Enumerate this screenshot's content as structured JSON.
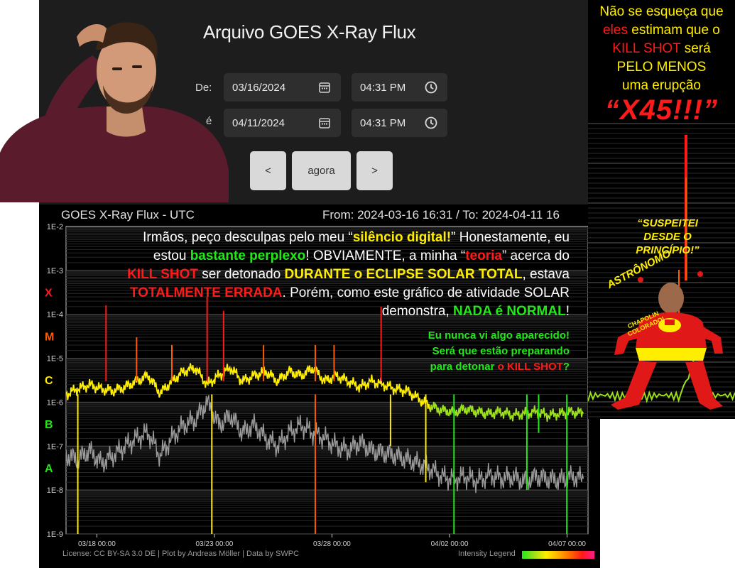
{
  "app": {
    "title": "Arquivo GOES X-Ray Flux"
  },
  "form": {
    "from_label": "De:",
    "to_label": "é",
    "from_date": "03/16/2024",
    "from_time": "04:31 PM",
    "to_date": "04/11/2024",
    "to_time": "04:31 PM",
    "prev": "<",
    "now": "agora",
    "next": ">"
  },
  "chart_header": {
    "title": "GOES X-Ray Flux - UTC",
    "range": "From: 2024-03-16 16:31  /  To: 2024-04-11 16"
  },
  "overlay": {
    "l1a": "Irmãos, peço desculpas pelo meu “",
    "l1b": "silêncio digital!",
    "l1c": "”   Honestamente, eu",
    "l2a": "estou ",
    "l2b": "bastante perplexo",
    "l2c": "!   OBVIAMENTE, a minha “",
    "l2d": "teoria",
    "l2e": "” acerca do",
    "l3a": "KILL SHOT",
    "l3b": " ser detonado ",
    "l3c": "DURANTE o ECLIPSE SOLAR TOTAL",
    "l3d": ", estava",
    "l4a": "TOTALMENTE ERRADA",
    "l4b": ".   Porém, como este gráfico de atividade SOLAR",
    "l5a": "demonstra, ",
    "l5b": "NADA é NORMAL",
    "l5c": "!",
    "g1": "Eu nunca vi algo aparecido!",
    "g2": "Será que estão preparando",
    "g3a": "para detonar ",
    "g3b": "o KILL SHOT",
    "g3c": "?"
  },
  "side_note": {
    "l1": "Não se esqueça que",
    "l2a": "eles",
    "l2b": " estimam que o",
    "l3a": "KILL SHOT",
    "l3b": " será",
    "l4": "PELO MENOS",
    "l5": "uma erupção",
    "big": "“X45!!!”",
    "susp1": "“SUSPEITEI",
    "susp2": "DESDE O",
    "susp3": "PRINCÍPIO!”",
    "astro": "ASTRÔNOMO",
    "chapo1": "CHAPOLIN",
    "chapo2": "COLORADO!"
  },
  "footer": {
    "license": "License: CC BY-SA 3.0 DE | Plot by Andreas Möller | Data by SWPC",
    "legend": "Intensity Legend"
  },
  "colors": {
    "long": "#ffee00",
    "short": "#9a9a9a",
    "m_class": "#ff5a00",
    "x_class": "#ff1a1a",
    "c_class": "#ffee00",
    "b_class": "#9be01a",
    "a_class": "#22e81a"
  },
  "chart_data": {
    "type": "line",
    "title": "GOES X-Ray Flux - UTC",
    "y_scale": "log",
    "ylim": [
      1e-09,
      0.01
    ],
    "y_ticks": [
      "1E-2",
      "1E-3",
      "1E-4",
      "1E-5",
      "1E-6",
      "1E-7",
      "1E-8",
      "1E-9"
    ],
    "class_labels": [
      {
        "label": "X",
        "value": 0.0001,
        "color": "#ff1a1a"
      },
      {
        "label": "M",
        "value": 1e-05,
        "color": "#ff5a00"
      },
      {
        "label": "C",
        "value": 1e-06,
        "color": "#ffee00"
      },
      {
        "label": "B",
        "value": 1e-07,
        "color": "#22e81a"
      },
      {
        "label": "A",
        "value": 1e-08,
        "color": "#22e81a"
      }
    ],
    "x_tick_labels": [
      "03/18 00:00",
      "03/23 00:00",
      "03/28 00:00",
      "04/02 00:00",
      "04/07 00:00"
    ],
    "x_tick_days": [
      1.31,
      6.31,
      11.31,
      16.31,
      21.31
    ],
    "xlim_days": [
      0,
      22.2
    ],
    "grid": true,
    "series": [
      {
        "color": "#ffee00",
        "x": [
          0,
          0.5,
          1,
          1.5,
          2,
          2.5,
          3,
          3.5,
          4,
          4.5,
          5,
          5.5,
          6,
          6.5,
          7,
          7.5,
          8,
          8.5,
          9,
          9.5,
          10,
          10.5,
          11,
          11.5,
          12,
          12.5,
          13,
          13.5,
          14,
          14.5,
          15,
          15.5,
          16,
          16.5,
          17,
          17.5,
          18,
          18.5,
          19,
          19.5,
          20,
          20.5,
          21,
          21.5,
          22
        ],
        "y": [
          1.5e-06,
          2e-06,
          2.5e-06,
          2e-06,
          1.8e-06,
          2.2e-06,
          3e-06,
          4e-06,
          1.6e-06,
          3e-06,
          5e-06,
          6e-06,
          2.5e-06,
          4e-06,
          6e-06,
          3e-06,
          4e-06,
          5e-06,
          3e-06,
          5e-06,
          4e-06,
          6e-06,
          3e-06,
          4e-06,
          3e-06,
          2.2e-06,
          3e-06,
          2.5e-06,
          2e-06,
          1.8e-06,
          1.2e-06,
          8e-07,
          6.5e-07,
          6e-07,
          7e-07,
          6e-07,
          5.5e-07,
          6e-07,
          5e-07,
          5.5e-07,
          6e-07,
          5e-07,
          5.5e-07,
          6e-07,
          5.5e-07
        ]
      },
      {
        "color": "#9a9a9a",
        "x": [
          0,
          0.5,
          1,
          1.5,
          2,
          2.5,
          3,
          3.5,
          4,
          4.5,
          5,
          5.5,
          6,
          6.5,
          7,
          7.5,
          8,
          8.5,
          9,
          9.5,
          10,
          10.5,
          11,
          11.5,
          12,
          12.5,
          13,
          13.5,
          14,
          14.5,
          15,
          15.5,
          16,
          16.5,
          17,
          17.5,
          18,
          18.5,
          19,
          19.5,
          20,
          20.5,
          21,
          21.5,
          22
        ],
        "y": [
          6e-08,
          5e-08,
          8e-08,
          4e-08,
          6e-08,
          1e-07,
          1.5e-07,
          2e-07,
          6e-08,
          1.5e-07,
          3e-07,
          4e-07,
          1e-06,
          3e-07,
          5e-07,
          2e-07,
          3e-07,
          1.5e-07,
          1e-07,
          2e-07,
          3e-07,
          2e-07,
          1.5e-07,
          1e-07,
          8e-08,
          1.2e-07,
          8e-08,
          7e-08,
          6e-08,
          5e-08,
          4e-08,
          3e-08,
          2e-08,
          1.8e-08,
          2e-08,
          1.6e-08,
          2.2e-08,
          1.8e-08,
          2e-08,
          1.6e-08,
          2e-08,
          1.8e-08,
          1.7e-08,
          2e-08,
          1.8e-08
        ]
      }
    ],
    "flares": [
      {
        "x": 1.7,
        "y": 0.00016,
        "class": "x"
      },
      {
        "x": 3.0,
        "y": 3e-05,
        "class": "m"
      },
      {
        "x": 4.5,
        "y": 2e-05,
        "class": "m"
      },
      {
        "x": 6.0,
        "y": 0.00025,
        "class": "x"
      },
      {
        "x": 6.7,
        "y": 0.00012,
        "class": "x"
      },
      {
        "x": 8.4,
        "y": 2e-05,
        "class": "m"
      },
      {
        "x": 10.6,
        "y": 2e-05,
        "class": "m"
      },
      {
        "x": 11.4,
        "y": 2e-05,
        "class": "m"
      },
      {
        "x": 13.4,
        "y": 0.00015,
        "class": "x"
      }
    ],
    "dropouts": [
      {
        "x": 0.5,
        "to": 1e-09,
        "color": "#ffee00"
      },
      {
        "x": 6.2,
        "to": 1e-09,
        "color": "#ffee00"
      },
      {
        "x": 10.6,
        "to": 1e-09,
        "color": "#ff5a00"
      },
      {
        "x": 13.8,
        "to": 1e-07,
        "color": "#ffee00"
      },
      {
        "x": 15.3,
        "to": 1.5e-08,
        "color": "#ffee00"
      },
      {
        "x": 16.5,
        "to": 1e-09,
        "color": "#22e81a"
      },
      {
        "x": 19.6,
        "to": 1e-08,
        "color": "#22e81a"
      },
      {
        "x": 20.1,
        "to": 2e-07,
        "color": "#22e81a"
      },
      {
        "x": 21.3,
        "to": 1e-09,
        "color": "#22e81a"
      }
    ]
  }
}
